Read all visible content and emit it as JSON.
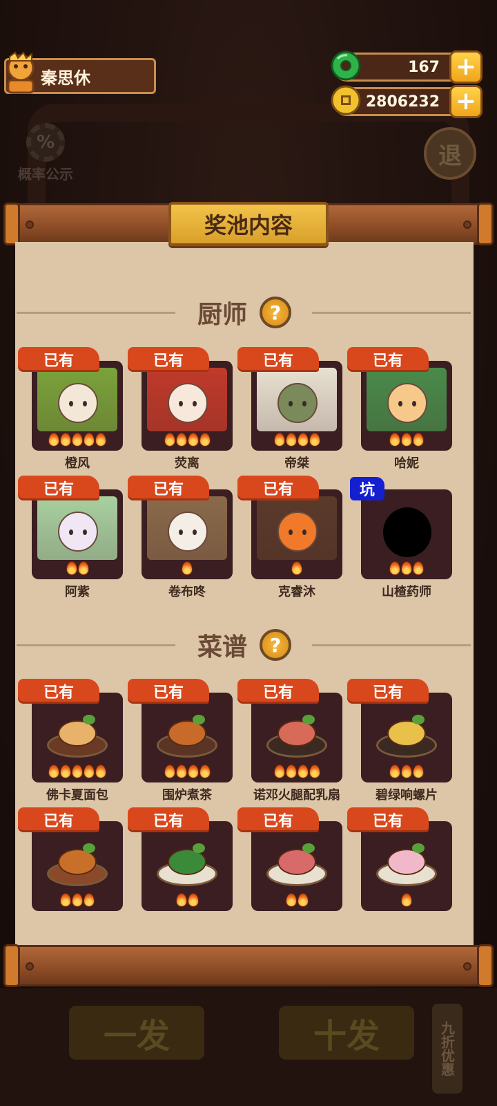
{
  "player": {
    "name": "秦思休"
  },
  "currencies": {
    "jade": {
      "value": "167",
      "icon": "jade-icon",
      "color": "#2fb24a"
    },
    "coin": {
      "value": "2806232",
      "icon": "coin-icon",
      "color": "#f2c12e"
    },
    "plus": "+"
  },
  "side": {
    "probability_label": "概率公示",
    "probability_symbol": "%",
    "exit_label": "退"
  },
  "panel": {
    "title": "奖池内容"
  },
  "sections": {
    "chef": {
      "title": "厨师",
      "help": "?"
    },
    "recipe": {
      "title": "菜谱",
      "help": "?"
    }
  },
  "badges": {
    "owned": "已有",
    "pit": "坑"
  },
  "chefs": [
    {
      "name": "橙风",
      "badge": "已有",
      "stars": 5
    },
    {
      "name": "荧离",
      "badge": "已有",
      "stars": 4
    },
    {
      "name": "帝桀",
      "badge": "已有",
      "stars": 4
    },
    {
      "name": "哈妮",
      "badge": "已有",
      "stars": 3
    },
    {
      "name": "阿紫",
      "badge": "已有",
      "stars": 2
    },
    {
      "name": "卷布咚",
      "badge": "已有",
      "stars": 1
    },
    {
      "name": "克睿沐",
      "badge": "已有",
      "stars": 1
    },
    {
      "name": "山楂药师",
      "badge": "坑",
      "stars": 3
    }
  ],
  "recipes": [
    {
      "name": "佛卡夏面包",
      "badge": "已有",
      "stars": 5
    },
    {
      "name": "围炉煮茶",
      "badge": "已有",
      "stars": 4
    },
    {
      "name": "诺邓火腿配乳扇",
      "badge": "已有",
      "stars": 4
    },
    {
      "name": "碧绿响螺片",
      "badge": "已有",
      "stars": 3
    },
    {
      "name": "",
      "badge": "已有",
      "stars": 3
    },
    {
      "name": "",
      "badge": "已有",
      "stars": 2
    },
    {
      "name": "",
      "badge": "已有",
      "stars": 2
    },
    {
      "name": "",
      "badge": "已有",
      "stars": 1
    }
  ],
  "background": {
    "single_draw": "一发",
    "ten_draw": "十发",
    "discount": "九折优惠"
  }
}
